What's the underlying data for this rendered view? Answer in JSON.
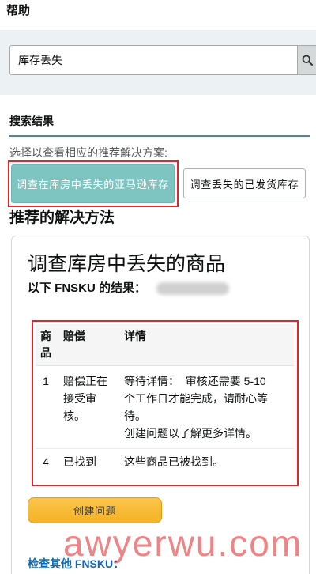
{
  "header": {
    "title": "帮助"
  },
  "search": {
    "value": "库存丢失",
    "button_icon": "search-icon"
  },
  "results": {
    "tab_label": "搜索结果",
    "instruction": "选择以查看相应的推荐解决方案:",
    "options": [
      {
        "label": "调查在库房中丢失的亚马逊库存",
        "selected": true
      },
      {
        "label": "调查丢失的已发货库存",
        "selected": false
      }
    ]
  },
  "solution": {
    "heading": "推荐的解决方法",
    "card_title": "调查库房中丢失的商品",
    "fnsku_label": "以下 FNSKU 的结果：",
    "table": {
      "columns": [
        "商品",
        "赔偿",
        "详情"
      ],
      "rows": [
        {
          "items": 1,
          "reimbursement": "赔偿正在接受审核。",
          "details": [
            "等待详情：  审核还需要 5-10 个工作日才能完成，请耐心等待。",
            "创建问题以了解更多详情。"
          ]
        },
        {
          "items": 4,
          "reimbursement": "已找到",
          "details": [
            "这些商品已被找到。"
          ]
        }
      ]
    },
    "create_issue_label": "创建问题",
    "check_other_label": "检查其他 FNSKU："
  },
  "watermark": "awyerwu.com",
  "colors": {
    "selected_option": "#7ec4c1",
    "annotation_box": "#e0262b",
    "create_issue_button": "#f5b224",
    "link": "#0b68b4",
    "tab_underline": "#4f8b93",
    "search_band": "#ecf2f3"
  }
}
